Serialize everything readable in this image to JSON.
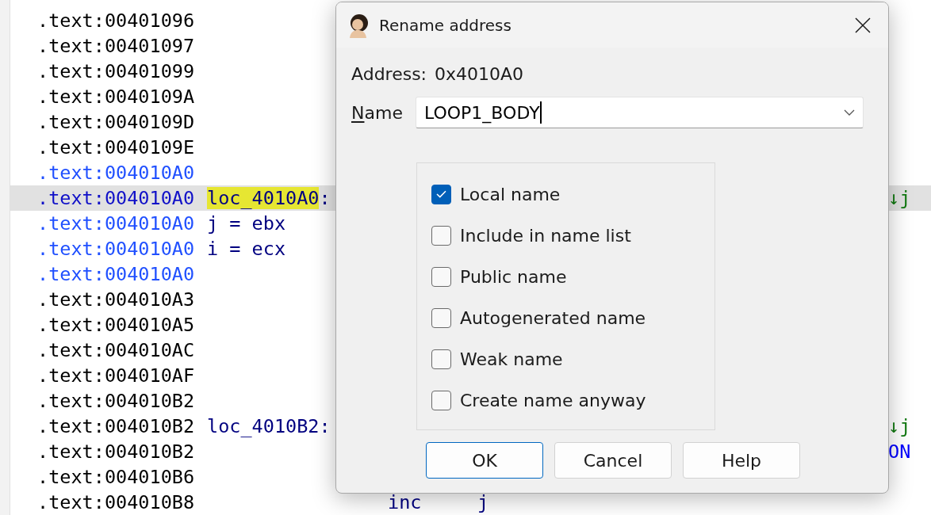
{
  "listing": {
    "rows": [
      {
        "address": ".text:00401096",
        "color": "#000000",
        "selected": false
      },
      {
        "address": ".text:00401097",
        "color": "#000000",
        "selected": false
      },
      {
        "address": ".text:00401099",
        "color": "#000000",
        "selected": false
      },
      {
        "address": ".text:0040109A",
        "color": "#000000",
        "selected": false
      },
      {
        "address": ".text:0040109D",
        "color": "#000000",
        "selected": false
      },
      {
        "address": ".text:0040109E",
        "color": "#000000",
        "selected": false
      },
      {
        "address": ".text:004010A0",
        "color": "#2050ff",
        "selected": false
      },
      {
        "address": ".text:004010A0",
        "color": "#1010c8",
        "selected": true,
        "label": {
          "name": "loc_4010A0",
          "suffix": ":",
          "highlighted": true
        },
        "comment": {
          "text": "↓j",
          "color": "#107810"
        }
      },
      {
        "address": ".text:004010A0",
        "color": "#2050ff",
        "selected": false,
        "statement": "j = ebx"
      },
      {
        "address": ".text:004010A0",
        "color": "#2050ff",
        "selected": false,
        "statement": "i = ecx"
      },
      {
        "address": ".text:004010A0",
        "color": "#2050ff",
        "selected": false
      },
      {
        "address": ".text:004010A3",
        "color": "#000000",
        "selected": false
      },
      {
        "address": ".text:004010A5",
        "color": "#000000",
        "selected": false
      },
      {
        "address": ".text:004010AC",
        "color": "#000000",
        "selected": false
      },
      {
        "address": ".text:004010AF",
        "color": "#000000",
        "selected": false
      },
      {
        "address": ".text:004010B2",
        "color": "#000000",
        "selected": false
      },
      {
        "address": ".text:004010B2",
        "color": "#000000",
        "selected": false,
        "label": {
          "name": "loc_4010B2",
          "suffix": ":",
          "highlighted": false
        },
        "comment": {
          "text": "↓j",
          "color": "#107810"
        }
      },
      {
        "address": ".text:004010B2",
        "color": "#000000",
        "selected": false,
        "comment": {
          "text": "ON",
          "color": "#0000ff"
        }
      },
      {
        "address": ".text:004010B6",
        "color": "#000000",
        "selected": false
      },
      {
        "address": ".text:004010B8",
        "color": "#000000",
        "selected": false,
        "mnemonic": "inc",
        "operand": "j"
      }
    ]
  },
  "dialog": {
    "title": "Rename address",
    "address_label": "Address:",
    "address_value": "0x4010A0",
    "name_label": [
      {
        "text": "N",
        "underlined": true
      },
      {
        "text": "ame",
        "underlined": false
      }
    ],
    "name_field": {
      "value": "LOOP1_BODY",
      "focused": true
    },
    "options": [
      {
        "label": "Local name",
        "checked": true
      },
      {
        "label": "Include in name list",
        "checked": false
      },
      {
        "label": "Public name",
        "checked": false
      },
      {
        "label": "Autogenerated name",
        "checked": false
      },
      {
        "label": "Weak name",
        "checked": false
      },
      {
        "label": "Create name anyway",
        "checked": false
      }
    ],
    "buttons": [
      {
        "label": "OK",
        "default": true
      },
      {
        "label": "Cancel",
        "default": false
      },
      {
        "label": "Help",
        "default": false
      }
    ]
  }
}
